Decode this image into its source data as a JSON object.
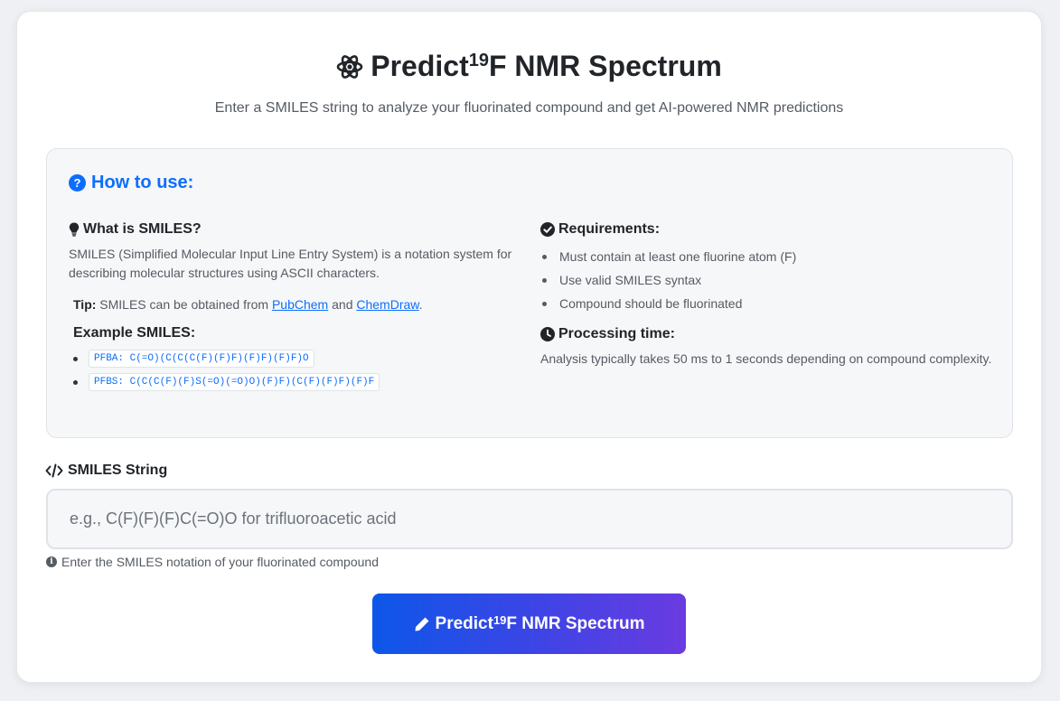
{
  "header": {
    "title_prefix": "Predict ",
    "title_sup": "19",
    "title_suffix": "F NMR Spectrum",
    "subtitle": "Enter a SMILES string to analyze your fluorinated compound and get AI-powered NMR predictions"
  },
  "howto": {
    "title": "How to use:",
    "what_title": "What is SMILES?",
    "what_text": "SMILES (Simplified Molecular Input Line Entry System) is a notation system for describing molecular structures using ASCII characters.",
    "tip_label": "Tip:",
    "tip_text": " SMILES can be obtained from ",
    "tip_link1": "PubChem",
    "tip_and": " and ",
    "tip_link2": "ChemDraw",
    "tip_end": ".",
    "examples_title": "Example SMILES:",
    "examples": [
      "PFBA: C(=O)(C(C(C(F)(F)F)(F)F)(F)F)O",
      "PFBS: C(C(C(F)(F)S(=O)(=O)O)(F)F)(C(F)(F)F)(F)F"
    ],
    "req_title": "Requirements:",
    "requirements": [
      "Must contain at least one fluorine atom (F)",
      "Use valid SMILES syntax",
      "Compound should be fluorinated"
    ],
    "proc_title": "Processing time:",
    "proc_text": "Analysis typically takes 50 ms to 1 seconds depending on compound complexity."
  },
  "form": {
    "label": "SMILES String",
    "placeholder": "e.g., C(F)(F)(F)C(=O)O for trifluoroacetic acid",
    "value": "",
    "help": "Enter the SMILES notation of your fluorinated compound",
    "button_prefix": "Predict ",
    "button_sup": "19",
    "button_suffix": "F NMR Spectrum"
  },
  "colors": {
    "accent": "#0d6efd",
    "button_gradient_start": "#0d57e8",
    "button_gradient_end": "#6a3be0"
  }
}
